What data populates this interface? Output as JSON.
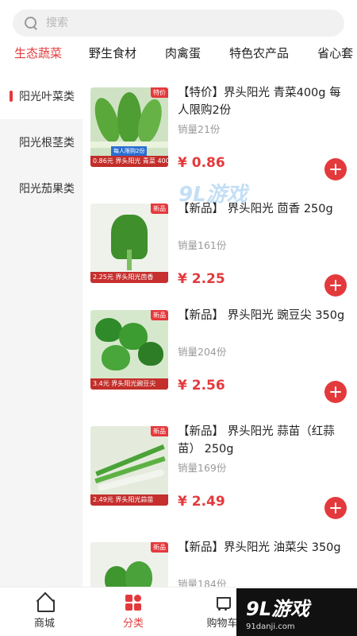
{
  "search": {
    "placeholder": "搜索"
  },
  "top_tabs": [
    "生态蔬菜",
    "野生食材",
    "肉禽蛋",
    "特色农产品",
    "省心套"
  ],
  "sidebar": {
    "items": [
      "阳光叶菜类",
      "阳光根茎类",
      "阳光茄果类"
    ]
  },
  "products": [
    {
      "title": "【特价】界头阳光 青菜400g 每人限购2份",
      "sales": "销量21份",
      "price": "¥ 0.86",
      "tag": "特价",
      "img_label": "0.86元 界头阳光 青菜 400g",
      "img_banner": "每人限购2份"
    },
    {
      "title": "【新品】 界头阳光 茴香 250g",
      "sales": "销量161份",
      "price": "¥ 2.25",
      "tag": "新品",
      "img_label": "2.25元 界头阳光茴香"
    },
    {
      "title": "【新品】 界头阳光 豌豆尖 350g",
      "sales": "销量204份",
      "price": "¥ 2.56",
      "tag": "新品",
      "img_label": "3.4元 界头阳光豌豆尖"
    },
    {
      "title": "【新品】 界头阳光 蒜苗（红蒜苗） 250g",
      "sales": "销量169份",
      "price": "¥ 2.49",
      "tag": "新品",
      "img_label": "2.49元 界头阳光蒜苗"
    },
    {
      "title": "【新品】界头阳光 油菜尖 350g",
      "sales": "销量184份",
      "price": "",
      "tag": "新品",
      "img_label": ""
    }
  ],
  "bottom_nav": {
    "items": [
      "商城",
      "分类",
      "购物车"
    ]
  },
  "watermark": {
    "middle": "9L游戏",
    "corner_big": "9L游戏",
    "corner_small": "91danji.com"
  },
  "colors": {
    "accent": "#e4393c",
    "sidebar_bg": "#f5f5f5"
  }
}
